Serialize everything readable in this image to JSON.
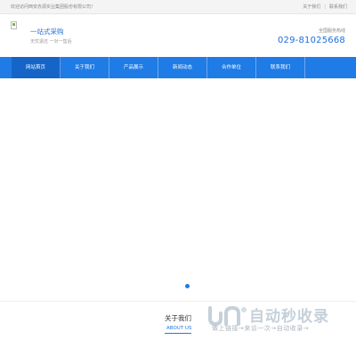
{
  "topbar": {
    "welcome": "欢迎访问西安赤源实业集团股份有限公司！",
    "links": [
      "关于我们",
      "联系我们"
    ]
  },
  "header": {
    "slogan": "一站式采购",
    "slogan_sub": "无忧退还 一对一售后",
    "hotline_label": "全国服务热线",
    "hotline": "029-81025668"
  },
  "nav": {
    "items": [
      "网站首页",
      "关于我们",
      "产品展示",
      "新闻动态",
      "合作单位",
      "联系我们"
    ],
    "active_index": 0
  },
  "banner": {
    "slide_count": 1,
    "active_slide": 1
  },
  "about": {
    "title": "关于我们",
    "subtitle": "ABOUT US"
  },
  "watermark": {
    "title": "自动秒收录",
    "subtitle": "做上链接→来访一次→自动收录→"
  },
  "colors": {
    "accent": "#1f7be6",
    "nav_active": "#1565c8",
    "topbar_bg": "#f4f4f4"
  }
}
